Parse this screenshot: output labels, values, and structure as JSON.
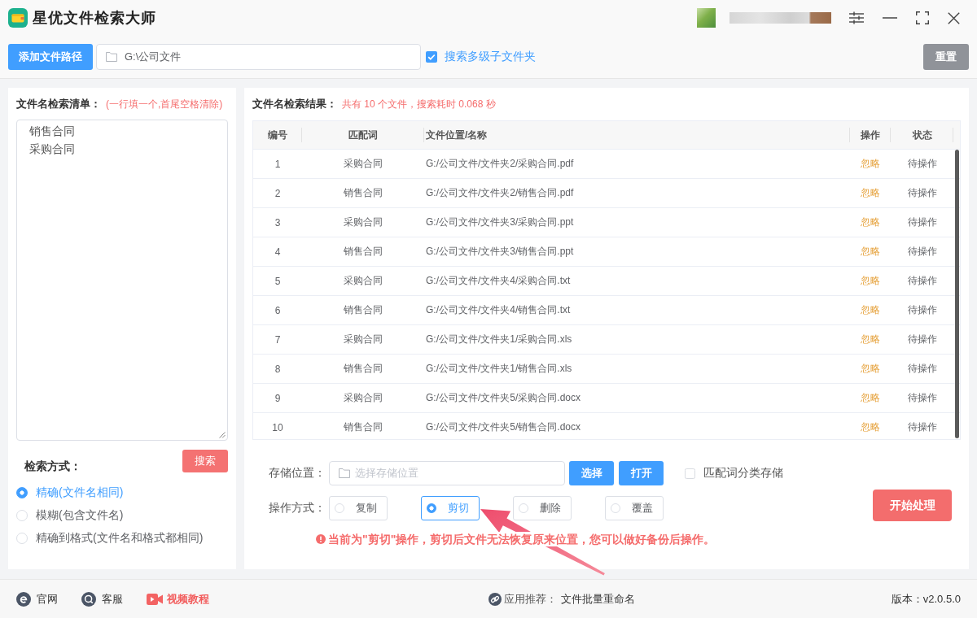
{
  "window": {
    "title": "星优文件检索大师"
  },
  "toolbar": {
    "add_path_button": "添加文件路径",
    "path_field": {
      "value": "G:\\公司文件"
    },
    "subfolders": {
      "label": "搜索多级子文件夹",
      "checked": true
    },
    "reset_button": "重置"
  },
  "keyword_panel": {
    "title": "文件名检索清单：",
    "hint": "(一行填一个,首尾空格清除)",
    "keywords": {
      "lines": [
        "销售合同",
        "采购合同"
      ]
    },
    "mode_title": "检索方式：",
    "search_button": "搜索",
    "modes": [
      {
        "label": "精确(文件名相同)",
        "selected": true
      },
      {
        "label": "模糊(包含文件名)",
        "selected": false
      },
      {
        "label": "精确到格式(文件名和格式都相同)",
        "selected": false
      }
    ]
  },
  "results_panel": {
    "title": "文件名检索结果：",
    "summary": "共有 10 个文件，搜索耗时 0.068 秒",
    "table": {
      "columns": [
        "编号",
        "匹配词",
        "文件位置/名称",
        "操作",
        "状态"
      ],
      "rows": [
        [
          "1",
          "采购合同",
          "G:/公司文件/文件夹2/采购合同.pdf",
          "忽略",
          "待操作"
        ],
        [
          "2",
          "销售合同",
          "G:/公司文件/文件夹2/销售合同.pdf",
          "忽略",
          "待操作"
        ],
        [
          "3",
          "采购合同",
          "G:/公司文件/文件夹3/采购合同.ppt",
          "忽略",
          "待操作"
        ],
        [
          "4",
          "销售合同",
          "G:/公司文件/文件夹3/销售合同.ppt",
          "忽略",
          "待操作"
        ],
        [
          "5",
          "采购合同",
          "G:/公司文件/文件夹4/采购合同.txt",
          "忽略",
          "待操作"
        ],
        [
          "6",
          "销售合同",
          "G:/公司文件/文件夹4/销售合同.txt",
          "忽略",
          "待操作"
        ],
        [
          "7",
          "采购合同",
          "G:/公司文件/文件夹1/采购合同.xls",
          "忽略",
          "待操作"
        ],
        [
          "8",
          "销售合同",
          "G:/公司文件/文件夹1/销售合同.xls",
          "忽略",
          "待操作"
        ],
        [
          "9",
          "采购合同",
          "G:/公司文件/文件夹5/采购合同.docx",
          "忽略",
          "待操作"
        ],
        [
          "10",
          "销售合同",
          "G:/公司文件/文件夹5/销售合同.docx",
          "忽略",
          "待操作"
        ]
      ]
    }
  },
  "output_panel": {
    "location_label": "存储位置：",
    "location_field": {
      "placeholder": "选择存储位置"
    },
    "choose_button": "选择",
    "open_button": "打开",
    "classify": {
      "label": "匹配词分类存储",
      "checked": false
    },
    "operation_label": "操作方式：",
    "operations": [
      {
        "label": "复制",
        "selected": false
      },
      {
        "label": "剪切",
        "selected": true
      },
      {
        "label": "删除",
        "selected": false
      },
      {
        "label": "覆盖",
        "selected": false
      }
    ],
    "start_button": "开始处理",
    "warning": "当前为\"剪切\"操作，剪切后文件无法恢复原来位置，您可以做好备份后操作。"
  },
  "footer": {
    "links": [
      {
        "kind": "web",
        "label": "官网"
      },
      {
        "kind": "chat",
        "label": "客服"
      },
      {
        "kind": "video",
        "label": "视频教程"
      }
    ],
    "recommend_label": "应用推荐：",
    "recommend_app": "文件批量重命名",
    "version": "版本：v2.0.5.0"
  }
}
